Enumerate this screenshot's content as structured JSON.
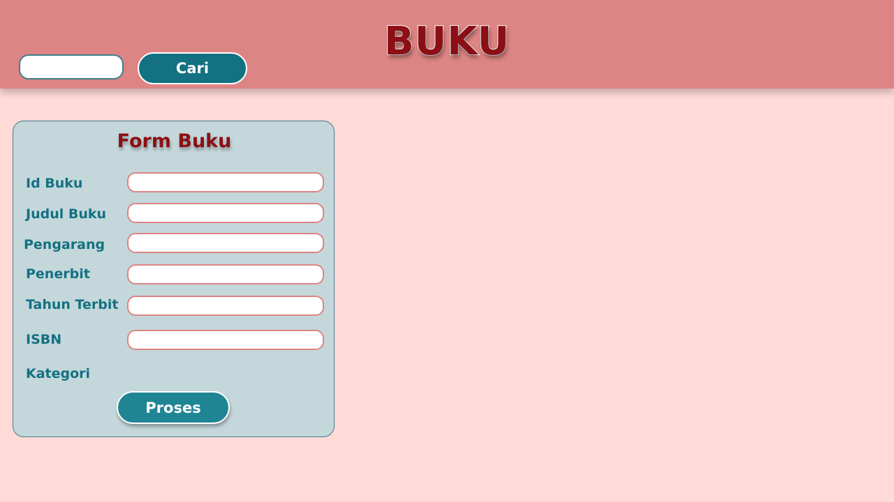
{
  "header": {
    "title": "BUKU",
    "search": {
      "value": "",
      "placeholder": ""
    },
    "search_button_label": "Cari"
  },
  "form": {
    "title": "Form Buku",
    "fields": [
      {
        "label": "Id Buku",
        "value": ""
      },
      {
        "label": "Judul Buku",
        "value": ""
      },
      {
        "label": "Pengarang",
        "value": ""
      },
      {
        "label": "Penerbit",
        "value": ""
      },
      {
        "label": "Tahun Terbit",
        "value": ""
      },
      {
        "label": "ISBN",
        "value": ""
      },
      {
        "label": "Kategori"
      }
    ],
    "submit_label": "Proses"
  },
  "colors": {
    "header_bg": "#dc8584",
    "page_bg": "#ffdad7",
    "panel_bg": "#c4d7db",
    "accent_teal": "#137181",
    "title_red": "#8b0f14"
  }
}
